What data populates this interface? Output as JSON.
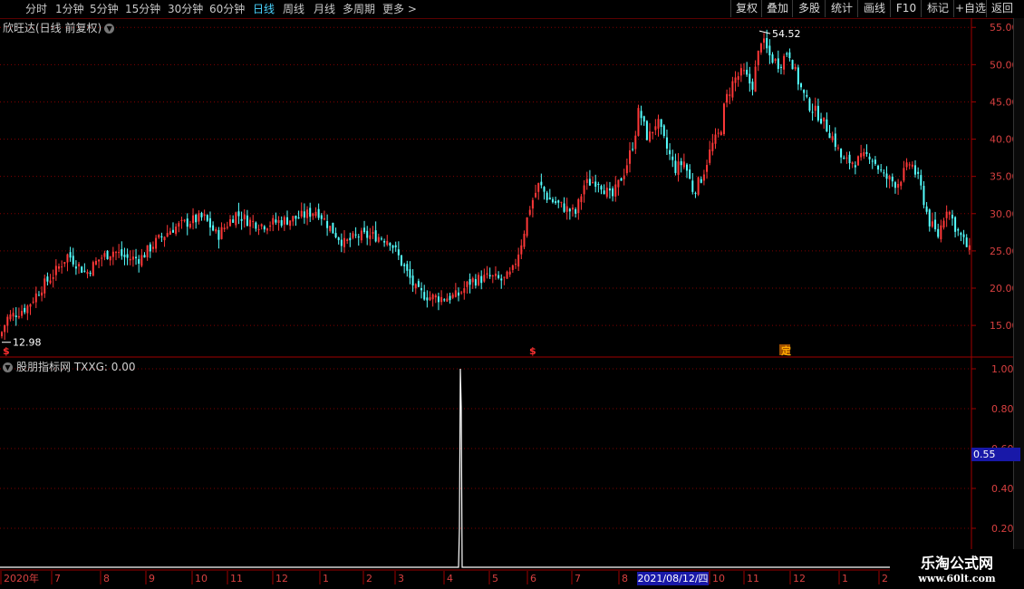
{
  "toolbar": {
    "periods": [
      "分时",
      "1分钟",
      "5分钟",
      "15分钟",
      "30分钟",
      "60分钟",
      "日线",
      "周线",
      "月线",
      "多周期",
      "更多 >"
    ],
    "active_period": "日线",
    "tools": [
      "复权",
      "叠加",
      "多股",
      "统计",
      "画线",
      "F10",
      "标记",
      "+自选",
      "返回"
    ]
  },
  "main": {
    "title": "欣旺达(日线 前复权)",
    "high_label": "54.52",
    "low_label": "12.98",
    "markers": [
      "$",
      "$",
      "定"
    ]
  },
  "indicator": {
    "title": "股朋指标网 TXXG: 0.00",
    "cursor_value": "0.55"
  },
  "x_axis": {
    "labels": [
      "2020年",
      "7",
      "8",
      "9",
      "10",
      "11",
      "12",
      "1",
      "2",
      "3",
      "4",
      "5",
      "6",
      "7",
      "8",
      "2021/08/12/四",
      "10",
      "11",
      "12",
      "1",
      "2"
    ]
  },
  "watermark": {
    "line1": "乐淘公式网",
    "line2": "www.60lt.com"
  },
  "colors": {
    "up": "#ff3838",
    "down": "#54ffff",
    "grid": "#800000",
    "axis": "#d84040",
    "signal": "#ffffff"
  },
  "chart_data": [
    {
      "type": "candlestick",
      "title": "欣旺达(日线 前复权)",
      "ylim": [
        11,
        56
      ],
      "y_ticks": [
        15.0,
        20.0,
        25.0,
        30.0,
        35.0,
        40.0,
        45.0,
        50.0,
        55.0
      ],
      "grid": true,
      "approx_close_path": [
        [
          0,
          13.5
        ],
        [
          8,
          16
        ],
        [
          16,
          16.5
        ],
        [
          30,
          17.5
        ],
        [
          45,
          20
        ],
        [
          60,
          22
        ],
        [
          75,
          24.5
        ],
        [
          95,
          22
        ],
        [
          110,
          24
        ],
        [
          125,
          25
        ],
        [
          140,
          24
        ],
        [
          155,
          24
        ],
        [
          170,
          26
        ],
        [
          190,
          28
        ],
        [
          210,
          29
        ],
        [
          225,
          29.5
        ],
        [
          240,
          27
        ],
        [
          260,
          30
        ],
        [
          275,
          29
        ],
        [
          290,
          28.5
        ],
        [
          310,
          29
        ],
        [
          330,
          29.5
        ],
        [
          350,
          30.5
        ],
        [
          365,
          28
        ],
        [
          380,
          26
        ],
        [
          395,
          27
        ],
        [
          415,
          27
        ],
        [
          430,
          26.5
        ],
        [
          445,
          23
        ],
        [
          460,
          19.5
        ],
        [
          475,
          18.8
        ],
        [
          490,
          18.7
        ],
        [
          505,
          19
        ],
        [
          520,
          21
        ],
        [
          540,
          21.5
        ],
        [
          555,
          21
        ],
        [
          565,
          22
        ],
        [
          575,
          26
        ],
        [
          585,
          31
        ],
        [
          595,
          34
        ],
        [
          605,
          32
        ],
        [
          620,
          31
        ],
        [
          635,
          30
        ],
        [
          645,
          34
        ],
        [
          660,
          34.5
        ],
        [
          675,
          32
        ],
        [
          690,
          36
        ],
        [
          700,
          40
        ],
        [
          705,
          44
        ],
        [
          715,
          40
        ],
        [
          725,
          42.5
        ],
        [
          735,
          39
        ],
        [
          745,
          36
        ],
        [
          755,
          37
        ],
        [
          765,
          33
        ],
        [
          775,
          35
        ],
        [
          785,
          39
        ],
        [
          795,
          41
        ],
        [
          800,
          45
        ],
        [
          810,
          48
        ],
        [
          820,
          49
        ],
        [
          830,
          47
        ],
        [
          840,
          53.5
        ],
        [
          850,
          51
        ],
        [
          860,
          50
        ],
        [
          870,
          52
        ],
        [
          880,
          48
        ],
        [
          890,
          45
        ],
        [
          905,
          43
        ],
        [
          920,
          40
        ],
        [
          930,
          37
        ],
        [
          945,
          37
        ],
        [
          960,
          38
        ],
        [
          975,
          35
        ],
        [
          990,
          34
        ],
        [
          1005,
          37
        ],
        [
          1015,
          34
        ],
        [
          1025,
          29
        ],
        [
          1035,
          27
        ],
        [
          1045,
          31
        ],
        [
          1055,
          28
        ],
        [
          1065,
          26
        ],
        [
          1072,
          24.5
        ]
      ]
    },
    {
      "type": "line",
      "title": "股朋指标网 TXXG: 0.00",
      "series": [
        {
          "name": "TXXG",
          "values": [
            0,
            1,
            0
          ]
        }
      ],
      "ylim": [
        0,
        1.05
      ],
      "y_ticks": [
        0.2,
        0.4,
        0.6,
        0.8,
        1.0
      ],
      "signal_date": "2021/04",
      "grid": true
    }
  ]
}
